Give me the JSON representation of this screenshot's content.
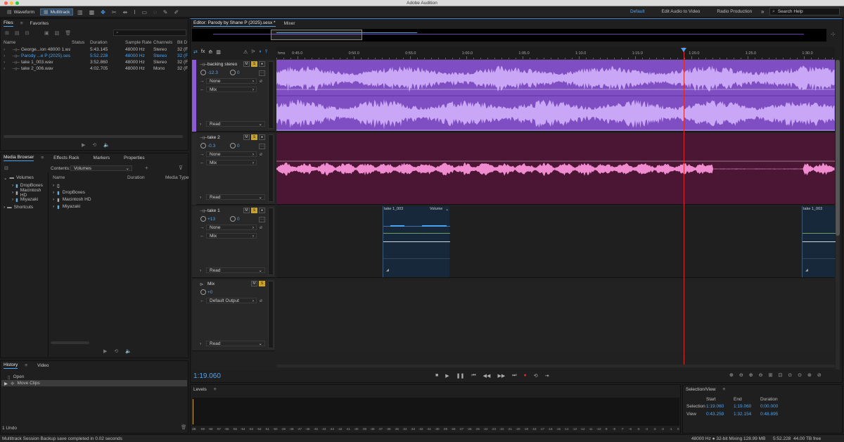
{
  "app": {
    "title": "Adobe Audition",
    "status": "Multitrack Session Backup save completed in 0.02 seconds"
  },
  "toolbar": {
    "waveform": "Waveform",
    "multitrack": "Multitrack",
    "workspaces": [
      "Default",
      "Edit Audio to Video",
      "Radio Production"
    ],
    "search_placeholder": "Search Help",
    "more": "»"
  },
  "files": {
    "tabs": [
      "Files",
      "Favorites"
    ],
    "columns": [
      "Name",
      "Status",
      "Duration",
      "Sample Rate",
      "Channels",
      "Bit D"
    ],
    "rows": [
      {
        "name": "George...ion 48000 1.wav",
        "status": "",
        "duration": "5:43.145",
        "rate": "48000 Hz",
        "channels": "Stereo",
        "bit": "32 (F",
        "active": false
      },
      {
        "name": "Parody ...e P (2025).sesx *",
        "status": "",
        "duration": "5:52.228",
        "rate": "48000 Hz",
        "channels": "Stereo",
        "bit": "32 (F",
        "active": true
      },
      {
        "name": "take 1_003.wav",
        "status": "",
        "duration": "3:52.860",
        "rate": "48000 Hz",
        "channels": "Stereo",
        "bit": "32 (F",
        "active": false
      },
      {
        "name": "take 2_006.wav",
        "status": "",
        "duration": "4:02.705",
        "rate": "48000 Hz",
        "channels": "Mono",
        "bit": "32 (F",
        "active": false
      }
    ]
  },
  "media": {
    "tabs": [
      "Media Browser",
      "Effects Rack",
      "Markers",
      "Properties"
    ],
    "contents_label": "Contents:",
    "contents_value": "Volumes",
    "col_name": "Name",
    "col_duration": "Duration",
    "col_type": "Media Type",
    "tree": [
      "Volumes",
      "DropBoxes",
      "Macintosh HD",
      "Miyazaki",
      "Shortcuts"
    ],
    "list": [
      "",
      "DropBoxes",
      "Macintosh HD",
      "Miyazaki"
    ]
  },
  "history": {
    "tabs": [
      "History",
      "Video"
    ],
    "items": [
      "Open",
      "Move Clips"
    ],
    "count": "1 Undo"
  },
  "editor": {
    "tabs": [
      "Editor: Parody by Shane P (2025).sesx *",
      "Mixer"
    ],
    "ruler_label": "hms",
    "ticks": [
      "0:45.0",
      "0:50.0",
      "0:55.0",
      "1:00.0",
      "1:05.0",
      "1:10.0",
      "1:15.0",
      "1:20.0",
      "1:25.0",
      "1:30.0"
    ],
    "time": "1:19.060"
  },
  "tracks": [
    {
      "name": "backing stereo",
      "volume": "-12.3",
      "pan": "0",
      "input": "None",
      "output": "Mix",
      "automation": "Read"
    },
    {
      "name": "take 2",
      "volume": "-0.3",
      "pan": "0",
      "input": "None",
      "output": "Mix",
      "automation": "Read"
    },
    {
      "name": "take 1",
      "volume": "+13",
      "pan": "0",
      "input": "None",
      "output": "Mix",
      "automation": "Read",
      "clip1": "take 1_003",
      "clip1_vol": "Volume",
      "clip2": "take 1_003"
    },
    {
      "name": "Mix",
      "volume": "+0",
      "output": "Default Output",
      "automation": "Read"
    }
  ],
  "levels": {
    "title": "Levels",
    "scale": [
      "dB",
      "-59",
      "-58",
      "-57",
      "-56",
      "-55",
      "-54",
      "-53",
      "-52",
      "-51",
      "-50",
      "-49",
      "-48",
      "-47",
      "-46",
      "-45",
      "-44",
      "-43",
      "-42",
      "-41",
      "-40",
      "-39",
      "-38",
      "-37",
      "-36",
      "-35",
      "-34",
      "-33",
      "-32",
      "-31",
      "-30",
      "-29",
      "-28",
      "-27",
      "-26",
      "-25",
      "-24",
      "-23",
      "-22",
      "-21",
      "-20",
      "-19",
      "-18",
      "-17",
      "-16",
      "-15",
      "-14",
      "-13",
      "-12",
      "-11",
      "-10",
      "-9",
      "-8",
      "-7",
      "-6",
      "-5",
      "-4",
      "-3",
      "-2",
      "-1",
      "0"
    ]
  },
  "selection": {
    "title": "Selection/View",
    "col_start": "Start",
    "col_end": "End",
    "col_duration": "Duration",
    "sel_label": "Selection",
    "sel_start": "1:19.060",
    "sel_end": "1:19.060",
    "sel_dur": "0:00.000",
    "view_label": "View",
    "view_start": "0:43.259",
    "view_end": "1:32.154",
    "view_dur": "0:48.895"
  },
  "statusbar": {
    "format": "48000 Hz ● 32-bit Mixing",
    "mem": "128.99 MB",
    "dur": "5:52.228",
    "free": "44.00 TB free"
  },
  "colors": {
    "accent": "#4ea3f0",
    "track1": "#7e4ec2",
    "track1_wave": "#c9a4f5",
    "track2": "#4b1634",
    "track2_wave": "#f08bd0",
    "clip": "#18283b",
    "playhead": "#e02a2a"
  }
}
